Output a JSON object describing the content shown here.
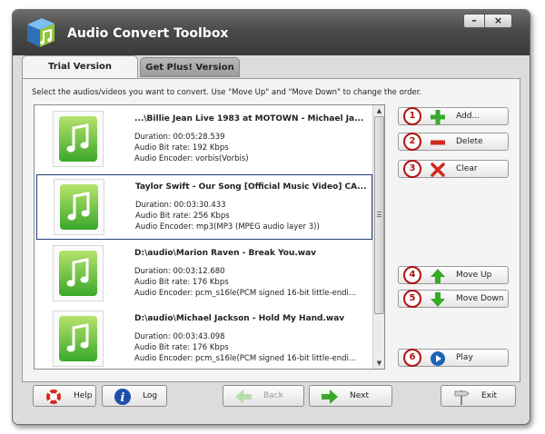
{
  "window": {
    "title": "Audio Convert Toolbox",
    "minimize_glyph": "–",
    "close_glyph": "×"
  },
  "tabs": [
    {
      "label": "Trial Version",
      "active": true
    },
    {
      "label": "Get Plus! Version",
      "active": false
    }
  ],
  "instruction": "Select the audios/videos you want to convert. Use \"Move Up\" and \"Move Down\" to change the order.",
  "files": [
    {
      "title": "...\\Billie Jean Live 1983 at MOTOWN - Michael Ja...",
      "duration": "Duration: 00:05:28.539",
      "bitrate": "Audio Bit rate: 192 Kbps",
      "encoder": "Audio Encoder: vorbis(Vorbis)",
      "selected": false
    },
    {
      "title": "Taylor Swift - Our Song [Official Music Video] CA...",
      "duration": "Duration: 00:03:30.433",
      "bitrate": "Audio Bit rate: 256 Kbps",
      "encoder": "Audio Encoder: mp3(MP3 (MPEG audio layer 3))",
      "selected": true
    },
    {
      "title": "D:\\audio\\Marion Raven - Break You.wav",
      "duration": "Duration: 00:03:12.680",
      "bitrate": "Audio Bit rate: 176 Kbps",
      "encoder": "Audio Encoder: pcm_s16le(PCM signed 16-bit little-endi...",
      "selected": false
    },
    {
      "title": "D:\\audio\\Michael Jackson - Hold My Hand.wav",
      "duration": "Duration: 00:03:43.098",
      "bitrate": "Audio Bit rate: 176 Kbps",
      "encoder": "Audio Encoder: pcm_s16le(PCM signed 16-bit little-endi...",
      "selected": false
    }
  ],
  "actions": {
    "add": {
      "label": "Add...",
      "num": "1"
    },
    "delete": {
      "label": "Delete",
      "num": "2"
    },
    "clear": {
      "label": "Clear",
      "num": "3"
    },
    "move_up": {
      "label": "Move Up",
      "num": "4"
    },
    "move_down": {
      "label": "Move Down",
      "num": "5"
    },
    "play": {
      "label": "Play",
      "num": "6"
    }
  },
  "bottom": {
    "help": "Help",
    "log": "Log",
    "back": "Back",
    "next": "Next",
    "exit": "Exit"
  },
  "colors": {
    "accent_green": "#3aa82a",
    "marker_red": "#b11212",
    "selection_border": "#1f3f7a"
  }
}
